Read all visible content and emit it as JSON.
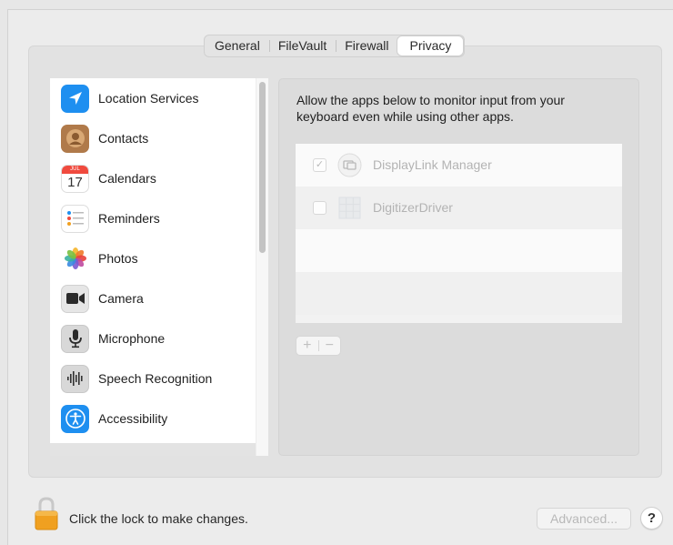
{
  "tabs": [
    {
      "label": "General",
      "selected": false
    },
    {
      "label": "FileVault",
      "selected": false
    },
    {
      "label": "Firewall",
      "selected": false
    },
    {
      "label": "Privacy",
      "selected": true
    }
  ],
  "sidebar": {
    "items": [
      {
        "label": "Location Services",
        "icon": "location-arrow-icon"
      },
      {
        "label": "Contacts",
        "icon": "contacts-icon"
      },
      {
        "label": "Calendars",
        "icon": "calendar-icon",
        "icon_month": "JUL",
        "icon_day": "17"
      },
      {
        "label": "Reminders",
        "icon": "reminders-icon"
      },
      {
        "label": "Photos",
        "icon": "photos-icon"
      },
      {
        "label": "Camera",
        "icon": "camera-icon"
      },
      {
        "label": "Microphone",
        "icon": "microphone-icon"
      },
      {
        "label": "Speech Recognition",
        "icon": "speech-recognition-icon"
      },
      {
        "label": "Accessibility",
        "icon": "accessibility-icon"
      }
    ]
  },
  "detail": {
    "description": "Allow the apps below to monitor input from your keyboard even while using other apps.",
    "apps": [
      {
        "name": "DisplayLink Manager",
        "checked": true,
        "icon": "displaylink-icon"
      },
      {
        "name": "DigitizerDriver",
        "checked": false,
        "icon": "digitizer-icon"
      }
    ],
    "add_label": "+",
    "remove_label": "−"
  },
  "footer": {
    "lock_text": "Click the lock to make changes.",
    "advanced_label": "Advanced...",
    "help_label": "?"
  },
  "colors": {
    "accent": "#1e8ff0",
    "lock": "#f0a020"
  }
}
